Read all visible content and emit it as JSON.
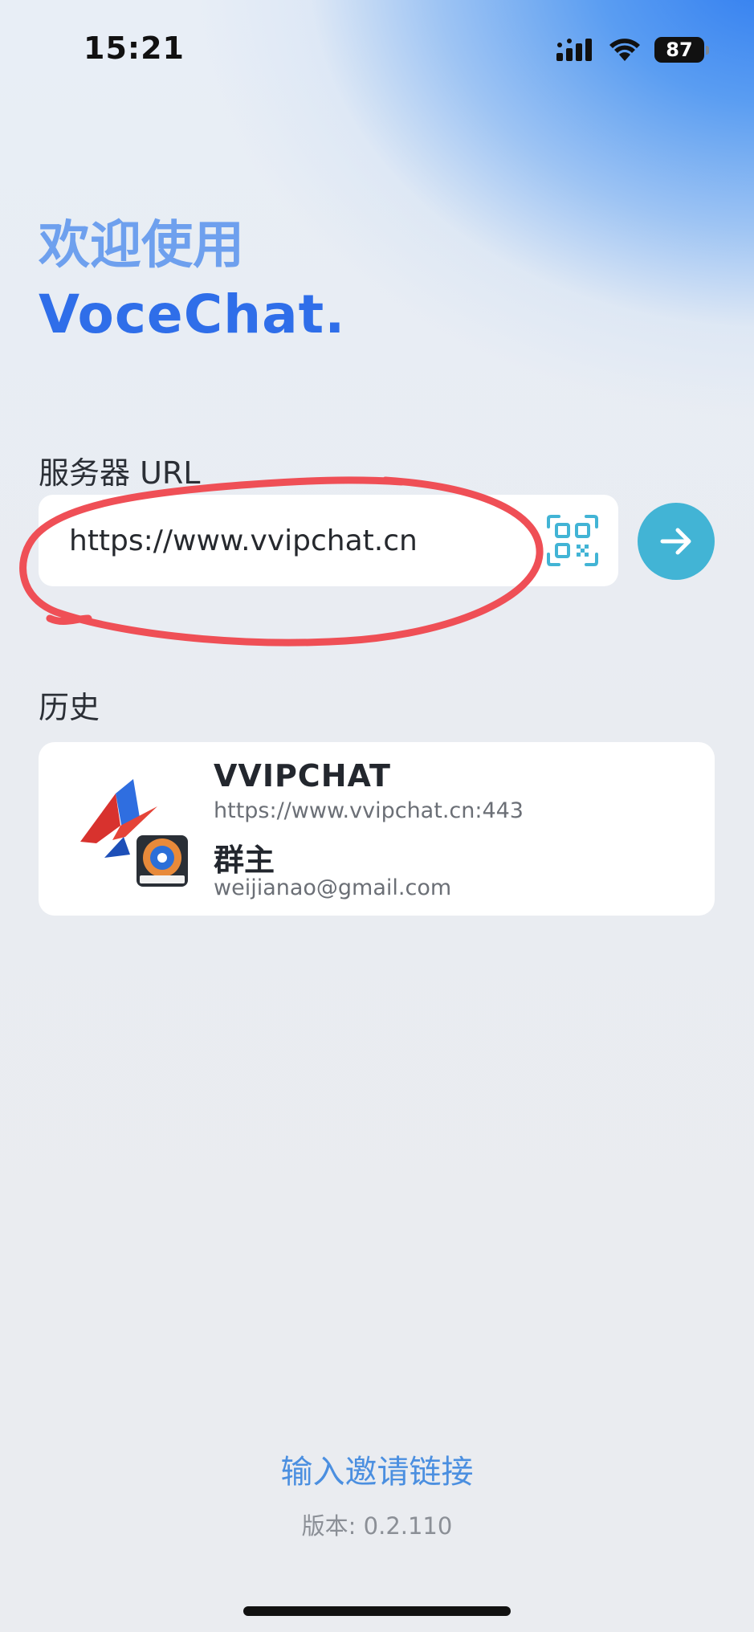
{
  "status_bar": {
    "time": "15:21",
    "battery": "87"
  },
  "welcome": {
    "line1": "欢迎使用",
    "line2": "VoceChat."
  },
  "server": {
    "label": "服务器 URL",
    "value": "https://www.vvipchat.cn"
  },
  "history": {
    "label": "历史",
    "items": [
      {
        "name": "VVIPCHAT",
        "url": "https://www.vvipchat.cn:443",
        "role": "群主",
        "email": "weijianao@gmail.com"
      }
    ]
  },
  "footer": {
    "invite_link": "输入邀请链接",
    "version": "版本: 0.2.110"
  },
  "colors": {
    "accent_blue": "#2f6ee9",
    "go_button": "#42b4d5",
    "qr_icon": "#42b4d5",
    "annotation": "#ef4f56",
    "invite_link": "#4b8fe0"
  },
  "icons": {
    "qr": "qr-code-scan-icon",
    "go": "arrow-right-icon",
    "signal": "cellular-signal-icon",
    "wifi": "wifi-icon",
    "battery": "battery-icon"
  }
}
